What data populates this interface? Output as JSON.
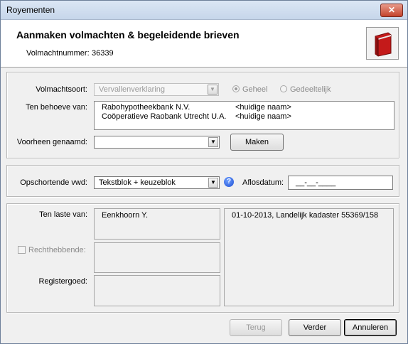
{
  "window": {
    "title": "Royementen",
    "close_glyph": "✕"
  },
  "header": {
    "title": "Aanmaken volmachten & begeleidende brieven",
    "volmacht_label": "Volmachtnummer:",
    "volmacht_value": "36339",
    "icon": "red-book-icon"
  },
  "section1": {
    "volmachtsoort_label": "Volmachtsoort:",
    "volmachtsoort_value": "Vervallenverklaring",
    "radio_geheel": "Geheel",
    "radio_gedeeltelijk": "Gedeeltelijk",
    "selected_radio": "Geheel",
    "ten_behoeve_label": "Ten behoeve van:",
    "ten_behoeve_rows": [
      {
        "name": "Rabohypotheekbank N.V.",
        "note": "<huidige naam>"
      },
      {
        "name": "Coöperatieve Raobank Utrecht U.A.",
        "note": "<huidige naam>"
      }
    ],
    "voorheen_label": "Voorheen genaamd:",
    "voorheen_value": "",
    "maken_button": "Maken"
  },
  "section2": {
    "opschortende_label": "Opschortende vwd:",
    "opschortende_value": "Tekstblok + keuzeblok",
    "aflos_label": "Aflosdatum:",
    "aflos_value": "__-__-____"
  },
  "section3": {
    "ten_laste_label": "Ten laste van:",
    "ten_laste_value": "Eenkhoorn Y.",
    "rechthebbende_label": "Rechthebbende:",
    "rechthebbende_checked": false,
    "registergoed_label": "Registergoed:",
    "kadaster_text": "01-10-2013, Landelijk kadaster 55369/158"
  },
  "footer": {
    "terug_button": "Terug",
    "verder_button": "Verder",
    "annuleren_button": "Annuleren"
  },
  "icons": {
    "dropdown": "▼",
    "help": "?"
  }
}
